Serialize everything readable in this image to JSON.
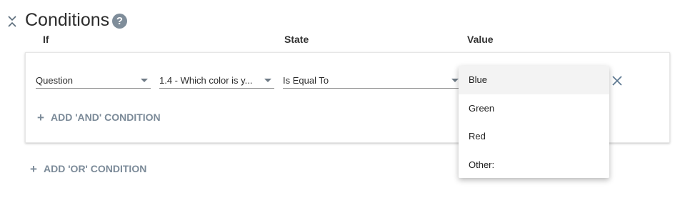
{
  "section": {
    "title": "Conditions",
    "help_icon": "question-circle-icon"
  },
  "columns": {
    "if": "If",
    "state": "State",
    "value": "Value"
  },
  "condition": {
    "source": "Question",
    "question": "1.4 - Which color is y...",
    "operator": "Is Equal To"
  },
  "add_and_label": "ADD 'AND' CONDITION",
  "add_or_label": "ADD 'OR' CONDITION",
  "value_options": [
    "Blue",
    "Green",
    "Red",
    "Other:"
  ],
  "highlighted_option": "Blue",
  "colors": {
    "accent": "#7b8a98",
    "help_icon_bg": "#7f8d9a",
    "menu_hover": "#f3f3f3"
  }
}
